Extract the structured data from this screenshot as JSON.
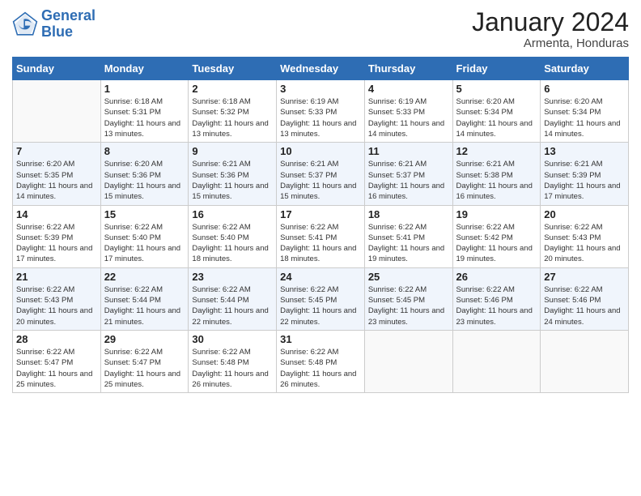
{
  "logo": {
    "line1": "General",
    "line2": "Blue"
  },
  "title": "January 2024",
  "subtitle": "Armenta, Honduras",
  "days_of_week": [
    "Sunday",
    "Monday",
    "Tuesday",
    "Wednesday",
    "Thursday",
    "Friday",
    "Saturday"
  ],
  "weeks": [
    [
      {
        "day": "",
        "info": ""
      },
      {
        "day": "1",
        "info": "Sunrise: 6:18 AM\nSunset: 5:31 PM\nDaylight: 11 hours\nand 13 minutes."
      },
      {
        "day": "2",
        "info": "Sunrise: 6:18 AM\nSunset: 5:32 PM\nDaylight: 11 hours\nand 13 minutes."
      },
      {
        "day": "3",
        "info": "Sunrise: 6:19 AM\nSunset: 5:33 PM\nDaylight: 11 hours\nand 13 minutes."
      },
      {
        "day": "4",
        "info": "Sunrise: 6:19 AM\nSunset: 5:33 PM\nDaylight: 11 hours\nand 14 minutes."
      },
      {
        "day": "5",
        "info": "Sunrise: 6:20 AM\nSunset: 5:34 PM\nDaylight: 11 hours\nand 14 minutes."
      },
      {
        "day": "6",
        "info": "Sunrise: 6:20 AM\nSunset: 5:34 PM\nDaylight: 11 hours\nand 14 minutes."
      }
    ],
    [
      {
        "day": "7",
        "info": "Sunrise: 6:20 AM\nSunset: 5:35 PM\nDaylight: 11 hours\nand 14 minutes."
      },
      {
        "day": "8",
        "info": "Sunrise: 6:20 AM\nSunset: 5:36 PM\nDaylight: 11 hours\nand 15 minutes."
      },
      {
        "day": "9",
        "info": "Sunrise: 6:21 AM\nSunset: 5:36 PM\nDaylight: 11 hours\nand 15 minutes."
      },
      {
        "day": "10",
        "info": "Sunrise: 6:21 AM\nSunset: 5:37 PM\nDaylight: 11 hours\nand 15 minutes."
      },
      {
        "day": "11",
        "info": "Sunrise: 6:21 AM\nSunset: 5:37 PM\nDaylight: 11 hours\nand 16 minutes."
      },
      {
        "day": "12",
        "info": "Sunrise: 6:21 AM\nSunset: 5:38 PM\nDaylight: 11 hours\nand 16 minutes."
      },
      {
        "day": "13",
        "info": "Sunrise: 6:21 AM\nSunset: 5:39 PM\nDaylight: 11 hours\nand 17 minutes."
      }
    ],
    [
      {
        "day": "14",
        "info": "Sunrise: 6:22 AM\nSunset: 5:39 PM\nDaylight: 11 hours\nand 17 minutes."
      },
      {
        "day": "15",
        "info": "Sunrise: 6:22 AM\nSunset: 5:40 PM\nDaylight: 11 hours\nand 17 minutes."
      },
      {
        "day": "16",
        "info": "Sunrise: 6:22 AM\nSunset: 5:40 PM\nDaylight: 11 hours\nand 18 minutes."
      },
      {
        "day": "17",
        "info": "Sunrise: 6:22 AM\nSunset: 5:41 PM\nDaylight: 11 hours\nand 18 minutes."
      },
      {
        "day": "18",
        "info": "Sunrise: 6:22 AM\nSunset: 5:41 PM\nDaylight: 11 hours\nand 19 minutes."
      },
      {
        "day": "19",
        "info": "Sunrise: 6:22 AM\nSunset: 5:42 PM\nDaylight: 11 hours\nand 19 minutes."
      },
      {
        "day": "20",
        "info": "Sunrise: 6:22 AM\nSunset: 5:43 PM\nDaylight: 11 hours\nand 20 minutes."
      }
    ],
    [
      {
        "day": "21",
        "info": "Sunrise: 6:22 AM\nSunset: 5:43 PM\nDaylight: 11 hours\nand 20 minutes."
      },
      {
        "day": "22",
        "info": "Sunrise: 6:22 AM\nSunset: 5:44 PM\nDaylight: 11 hours\nand 21 minutes."
      },
      {
        "day": "23",
        "info": "Sunrise: 6:22 AM\nSunset: 5:44 PM\nDaylight: 11 hours\nand 22 minutes."
      },
      {
        "day": "24",
        "info": "Sunrise: 6:22 AM\nSunset: 5:45 PM\nDaylight: 11 hours\nand 22 minutes."
      },
      {
        "day": "25",
        "info": "Sunrise: 6:22 AM\nSunset: 5:45 PM\nDaylight: 11 hours\nand 23 minutes."
      },
      {
        "day": "26",
        "info": "Sunrise: 6:22 AM\nSunset: 5:46 PM\nDaylight: 11 hours\nand 23 minutes."
      },
      {
        "day": "27",
        "info": "Sunrise: 6:22 AM\nSunset: 5:46 PM\nDaylight: 11 hours\nand 24 minutes."
      }
    ],
    [
      {
        "day": "28",
        "info": "Sunrise: 6:22 AM\nSunset: 5:47 PM\nDaylight: 11 hours\nand 25 minutes."
      },
      {
        "day": "29",
        "info": "Sunrise: 6:22 AM\nSunset: 5:47 PM\nDaylight: 11 hours\nand 25 minutes."
      },
      {
        "day": "30",
        "info": "Sunrise: 6:22 AM\nSunset: 5:48 PM\nDaylight: 11 hours\nand 26 minutes."
      },
      {
        "day": "31",
        "info": "Sunrise: 6:22 AM\nSunset: 5:48 PM\nDaylight: 11 hours\nand 26 minutes."
      },
      {
        "day": "",
        "info": ""
      },
      {
        "day": "",
        "info": ""
      },
      {
        "day": "",
        "info": ""
      }
    ]
  ]
}
